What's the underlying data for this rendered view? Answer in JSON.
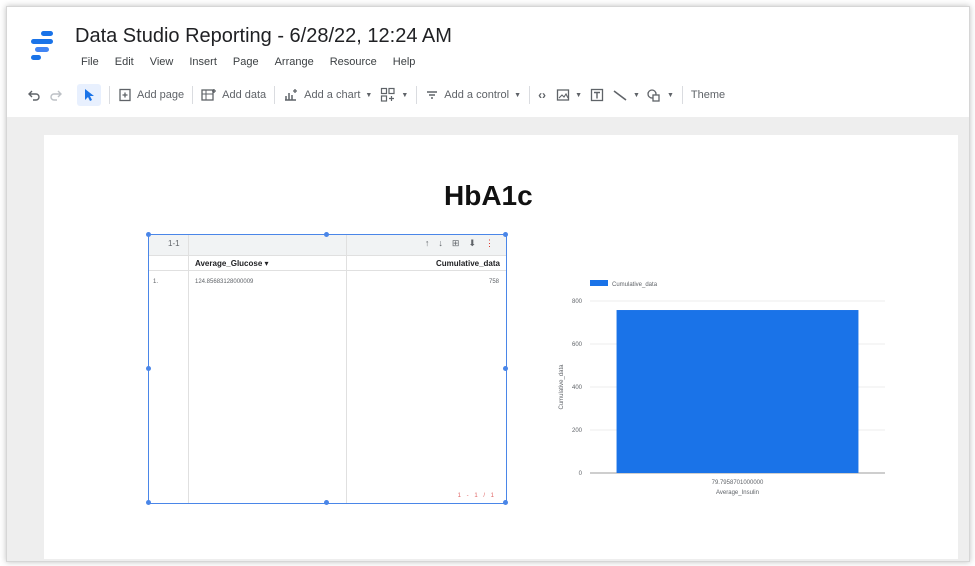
{
  "app": {
    "title": "Data Studio Reporting - 6/28/22, 12:24 AM",
    "menu": [
      "File",
      "Edit",
      "View",
      "Insert",
      "Page",
      "Arrange",
      "Resource",
      "Help"
    ]
  },
  "toolbar": {
    "add_page": "Add page",
    "add_data": "Add data",
    "add_chart": "Add a chart",
    "add_control": "Add a control",
    "theme": "Theme"
  },
  "report": {
    "title": "HbA1c"
  },
  "table": {
    "row_count": "1-1",
    "columns": [
      "Average_Glucose",
      "Cumulative_data"
    ],
    "rows": [
      {
        "index": "1.",
        "average_glucose": "124.85683128000009",
        "cumulative_data": "758"
      }
    ],
    "pagination": "1 - 1 / 1"
  },
  "chart_data": {
    "type": "bar",
    "legend": "Cumulative_data",
    "categories": [
      "79.7958701000000"
    ],
    "series": [
      {
        "name": "Cumulative_data",
        "values": [
          758
        ]
      }
    ],
    "xlabel": "Average_Insulin",
    "ylabel": "Cumulative_data",
    "yticks": [
      0,
      200,
      400,
      600,
      800
    ],
    "ylim": [
      0,
      800
    ],
    "color": "#1a73e8"
  }
}
